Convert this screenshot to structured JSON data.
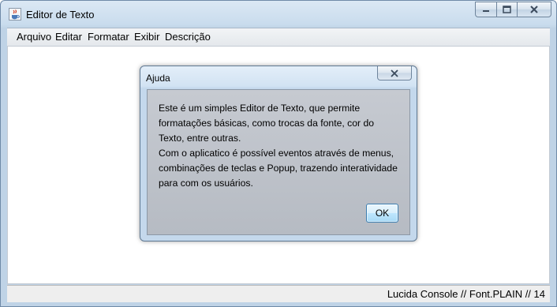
{
  "window": {
    "title": "Editor de Texto"
  },
  "menubar": {
    "items": [
      "Arquivo",
      "Editar",
      "Formatar",
      "Exibir",
      "Descrição"
    ]
  },
  "statusbar": {
    "text": "Lucida Console // Font.PLAIN // 14"
  },
  "dialog": {
    "title": "Ajuda",
    "message_lines": [
      "Este é um simples Editor de Texto, que permite",
      "formatações básicas, como trocas da fonte, cor do",
      "Texto, entre outras.",
      "Com o aplicatico é possível eventos através de menus,",
      "combinações de teclas e Popup, trazendo interatividade",
      "para com os usuários."
    ],
    "ok_label": "OK"
  },
  "icons": {
    "app": "java-cup-icon",
    "minimize": "minimize-icon",
    "maximize": "maximize-icon",
    "close": "close-icon"
  },
  "colors": {
    "titlebar": "#c9dced",
    "dialog_body": "#bfc3ca",
    "ok_button": "#bee6fd"
  }
}
